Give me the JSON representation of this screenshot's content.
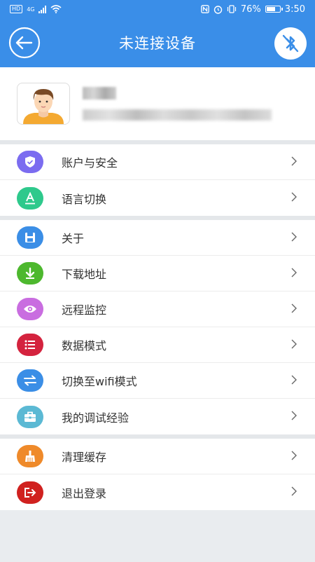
{
  "status_bar": {
    "hd": "HD",
    "net": "4G",
    "battery": "76%",
    "battery_level": 0.76,
    "time": "3:50"
  },
  "header": {
    "title": "未连接设备"
  },
  "menu": {
    "group1": [
      {
        "label": "账户与安全",
        "icon": "shield-icon",
        "color": "#7b6cf0"
      },
      {
        "label": "语言切换",
        "icon": "language-icon",
        "color": "#2ec98c"
      }
    ],
    "group2": [
      {
        "label": "关于",
        "icon": "save-icon",
        "color": "#3b8ee6"
      },
      {
        "label": "下载地址",
        "icon": "download-icon",
        "color": "#4db82e"
      },
      {
        "label": "远程监控",
        "icon": "eye-icon",
        "color": "#c96de0"
      },
      {
        "label": "数据模式",
        "icon": "list-icon",
        "color": "#d4233e"
      },
      {
        "label": "切换至wifi模式",
        "icon": "swap-icon",
        "color": "#3b8ee6"
      },
      {
        "label": "我的调试经验",
        "icon": "toolbox-icon",
        "color": "#5bb9d4"
      }
    ],
    "group3": [
      {
        "label": "清理缓存",
        "icon": "broom-icon",
        "color": "#ef8a2a"
      },
      {
        "label": "退出登录",
        "icon": "logout-icon",
        "color": "#d0211f"
      }
    ]
  }
}
